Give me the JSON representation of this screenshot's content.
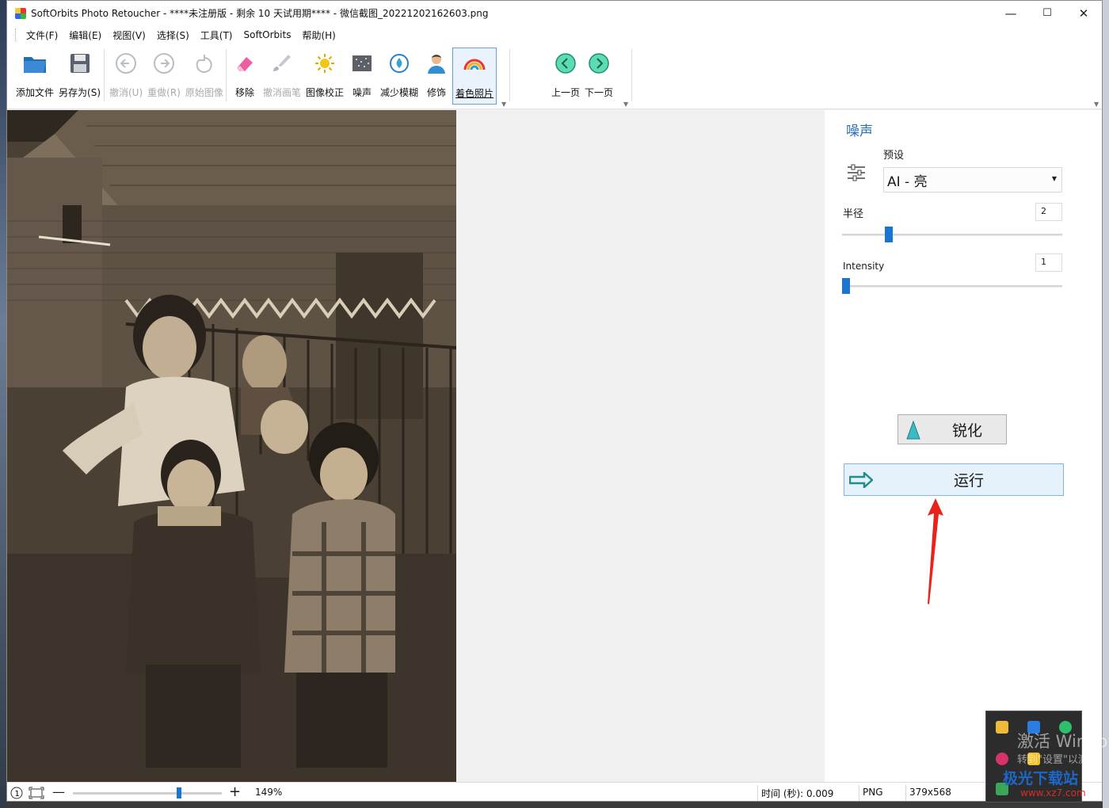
{
  "window": {
    "title": "SoftOrbits Photo Retoucher - ****未注册版 - 剩余 10 天试用期**** - 微信截图_20221202162603.png",
    "controls": {
      "minimize": "—",
      "maximize": "☐",
      "close": "✕"
    }
  },
  "menu": [
    "文件(F)",
    "编辑(E)",
    "视图(V)",
    "选择(S)",
    "工具(T)",
    "SoftOrbits",
    "帮助(H)"
  ],
  "toolbar": {
    "file": [
      {
        "label": "添加文件",
        "icon": "open-folder-icon"
      },
      {
        "label": "另存为(S)",
        "icon": "save-icon"
      }
    ],
    "history": [
      {
        "label": "撤消(U)",
        "icon": "undo-icon",
        "disabled": true
      },
      {
        "label": "重做(R)",
        "icon": "redo-icon",
        "disabled": true
      },
      {
        "label": "原始图像",
        "icon": "original-image-icon",
        "disabled": true
      }
    ],
    "tools": [
      {
        "label": "移除",
        "icon": "eraser-icon"
      },
      {
        "label": "撤消画笔",
        "icon": "undo-brush-icon",
        "disabled": true
      },
      {
        "label": "图像校正",
        "icon": "brightness-icon"
      },
      {
        "label": "噪声",
        "icon": "noise-icon"
      },
      {
        "label": "减少模糊",
        "icon": "deblur-icon"
      },
      {
        "label": "修饰",
        "icon": "retouch-person-icon"
      },
      {
        "label": "着色照片",
        "icon": "colorize-rainbow-icon",
        "active": true
      }
    ],
    "nav": [
      {
        "label": "上一页",
        "icon": "previous-page-icon"
      },
      {
        "label": "下一页",
        "icon": "next-page-icon"
      }
    ]
  },
  "panel": {
    "title": "噪声",
    "preset_label": "预设",
    "preset_value": "AI - 亮",
    "radius": {
      "label": "半径",
      "value": "2",
      "level": 0.2
    },
    "intensity": {
      "label": "Intensity",
      "value": "1",
      "level": 0.0
    },
    "sharpen_label": "锐化",
    "run_label": "运行"
  },
  "status": {
    "zoom": "149%",
    "zoom_level": 0.72,
    "time": "时间 (秒): 0.009",
    "format": "PNG",
    "size": "379x568"
  },
  "overlay": {
    "activate_title": "激活 Windows",
    "activate_hint": "转到\"设置\"以激活",
    "site_name": "极光下载站",
    "site_url": "www.xz7.com"
  },
  "colors": {
    "accent": "#1876d2",
    "panel_title": "#2a6ebb",
    "run_button_bg": "#e5f1fb",
    "annotation_arrow": "#e8231c"
  }
}
